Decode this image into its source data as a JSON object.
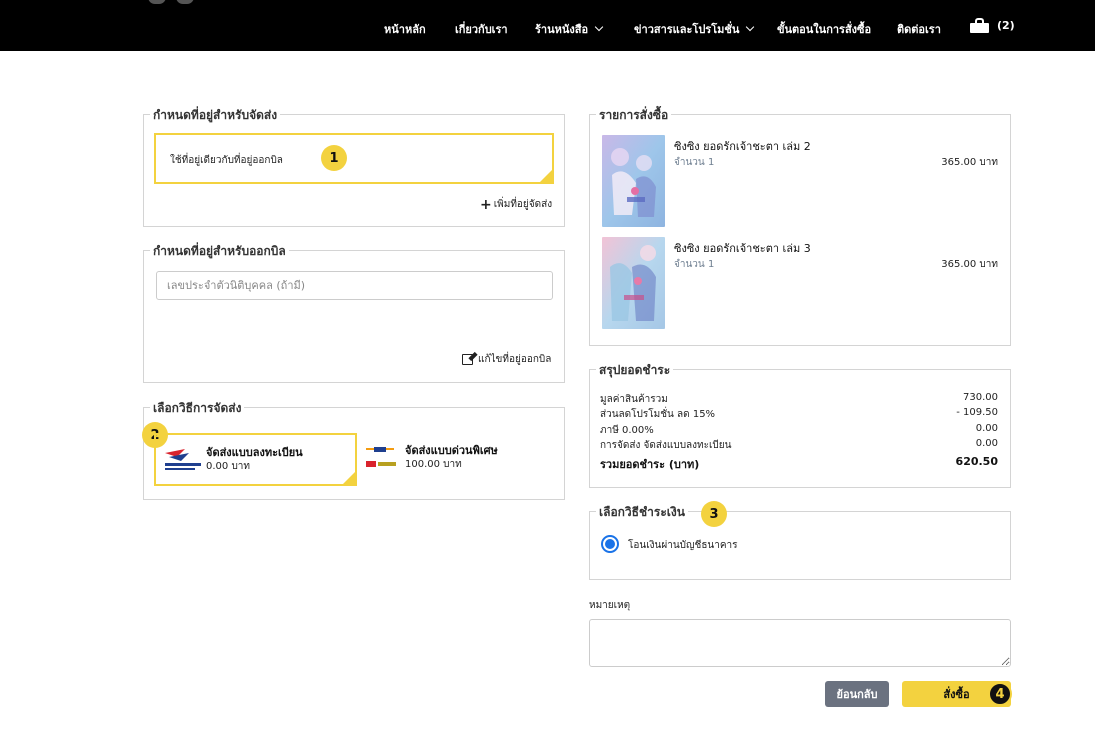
{
  "nav": {
    "items": [
      "หน้าหลัก",
      "เกี่ยวกับเรา",
      "ร้านหนังสือ",
      "ข่าวสารและโปรโมชั่น",
      "ขั้นตอนในการสั่งซื้อ",
      "ติดต่อเรา"
    ],
    "cart_count": "(2)"
  },
  "shipping_address": {
    "legend": "กำหนดที่อยู่สำหรับจัดส่ง",
    "selected_card": "ใช้ที่อยู่เดียวกับที่อยู่ออกบิล",
    "add_link": "เพิ่มที่อยู่จัดส่ง",
    "step": "1"
  },
  "billing_address": {
    "legend": "กำหนดที่อยู่สำหรับออกบิล",
    "tax_id_placeholder": "เลขประจำตัวนิติบุคคล (ถ้ามี)",
    "tax_id_value": "",
    "edit_link": "แก้ไขที่อยู่ออกบิล"
  },
  "shipping_method": {
    "legend": "เลือกวิธีการจัดส่ง",
    "step": "2",
    "options": [
      {
        "name": "จัดส่งแบบลงทะเบียน",
        "price": "0.00 บาท",
        "selected": true
      },
      {
        "name": "จัดส่งแบบด่วนพิเศษ",
        "price": "100.00 บาท",
        "selected": false
      }
    ]
  },
  "order_items": {
    "legend": "รายการสั่งซื้อ",
    "items": [
      {
        "title": "ซิงซิง ยอดรักเจ้าชะตา เล่ม 2",
        "qty": "จำนวน 1",
        "price": "365.00 บาท"
      },
      {
        "title": "ซิงซิง ยอดรักเจ้าชะตา เล่ม 3",
        "qty": "จำนวน 1",
        "price": "365.00 บาท"
      }
    ]
  },
  "summary": {
    "legend": "สรุปยอดชำระ",
    "rows": [
      {
        "label": "มูลค่าสินค้ารวม",
        "value": "730.00"
      },
      {
        "label": "ส่วนลดโปรโมชั่น ลด 15%",
        "value": "- 109.50"
      },
      {
        "label": "ภาษี 0.00%",
        "value": "0.00"
      },
      {
        "label": "การจัดส่ง จัดส่งแบบลงทะเบียน",
        "value": "0.00"
      }
    ],
    "total_label": "รวมยอดชำระ (บาท)",
    "total_value": "620.50"
  },
  "payment": {
    "legend": "เลือกวิธีชำระเงิน",
    "step": "3",
    "option": "โอนเงินผ่านบัญชีธนาคาร"
  },
  "note": {
    "label": "หมายเหตุ",
    "value": ""
  },
  "actions": {
    "back_label": "ย้อนกลับ",
    "order_label": "สั่งซื้อ",
    "step": "4"
  },
  "colors": {
    "accent": "#f3d23f",
    "navbar": "#000000",
    "radio": "#1a73e8"
  }
}
